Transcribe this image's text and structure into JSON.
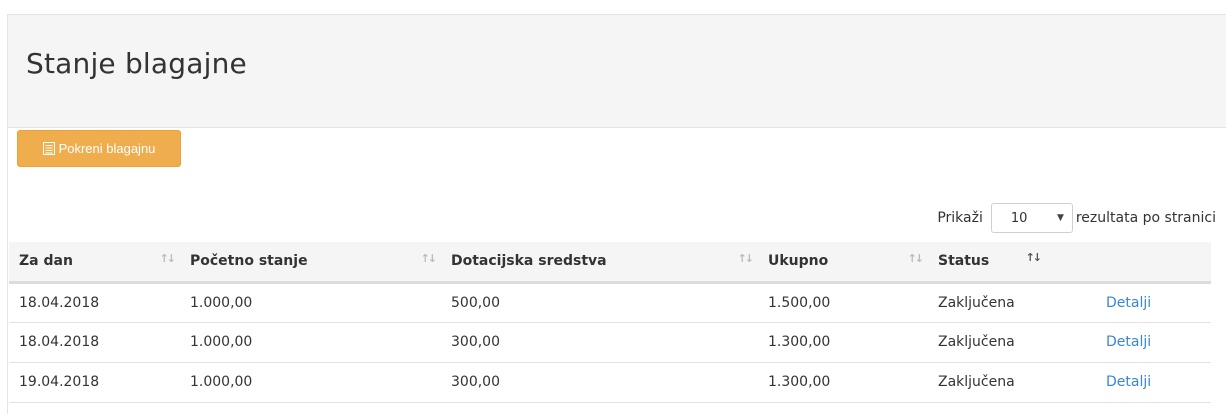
{
  "page": {
    "title": "Stanje blagajne"
  },
  "actions": {
    "start_label": "Pokreni blagajnu",
    "start_icon": "list-icon",
    "button_color": "#f0ad4e"
  },
  "length": {
    "prefix": "Prikaži",
    "value": "10",
    "suffix": "rezultata po stranici"
  },
  "table": {
    "headers": [
      "Za dan",
      "Početno stanje",
      "Dotacijska sredstva",
      "Ukupno",
      "Status",
      ""
    ],
    "rows": [
      {
        "date": "18.04.2018",
        "start": "1.000,00",
        "grant": "500,00",
        "total": "1.500,00",
        "status": "Zaključena",
        "action": "Detalji"
      },
      {
        "date": "18.04.2018",
        "start": "1.000,00",
        "grant": "300,00",
        "total": "1.300,00",
        "status": "Zaključena",
        "action": "Detalji"
      },
      {
        "date": "19.04.2018",
        "start": "1.000,00",
        "grant": "300,00",
        "total": "1.300,00",
        "status": "Zaključena",
        "action": "Detalji"
      }
    ]
  }
}
